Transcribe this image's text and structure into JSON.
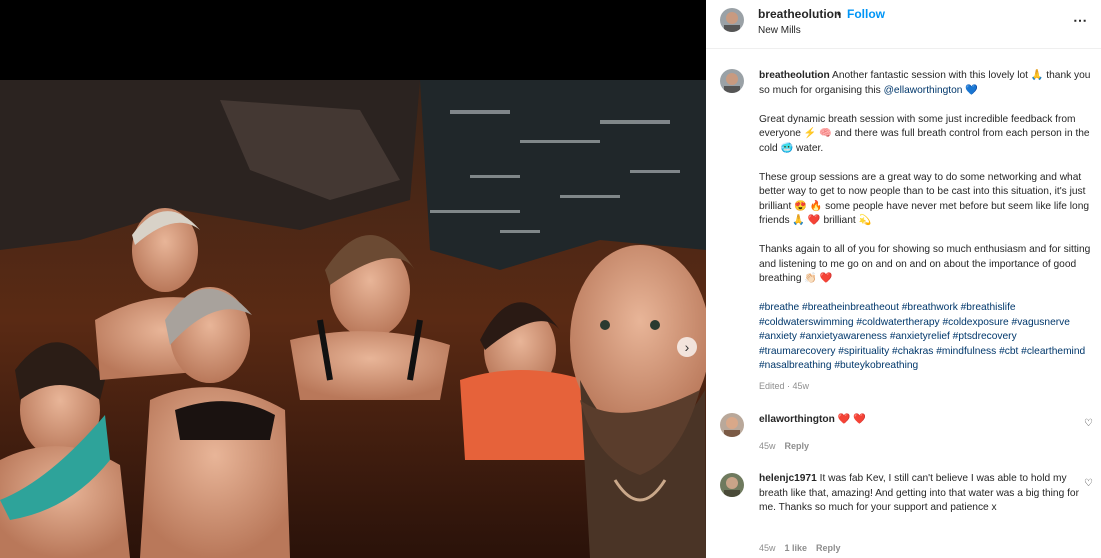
{
  "post": {
    "author": "breatheolution",
    "follow_label": "Follow",
    "dot": "•",
    "location": "New Mills",
    "more_icon": "⋯"
  },
  "caption": {
    "username": "breatheolution",
    "p1_a": "Another fantastic session with this lovely lot 🙏 thank you so much for organising this ",
    "mention": "@ellaworthington",
    "p1_b": " 💙",
    "p2": "Great dynamic breath session with some just incredible feedback from everyone ⚡ 🧠 and there was full breath control from each person in the cold 🥶 water.",
    "p3": "These group sessions are a great way to do some networking and what better way to get to now people than to be cast into this situation, it's just brilliant 😍 🔥 some people have never met before but seem like life long friends 🙏 ❤️ brilliant 💫",
    "p4": "Thanks again to all of you for showing so much enthusiasm and for sitting and listening to me go on and on and on about the importance of good breathing 👏🏻 ❤️",
    "hashtags": "#breathe #breatheinbreatheout #breathwork #breathislife #coldwaterswimming #coldwatertherapy #coldexposure #vagusnerve #anxiety #anxietyawareness #anxietyrelief #ptsdrecovery #traumarecovery #spirituality #chakras #mindfulness #cbt #clearthemind #nasalbreathing #buteykobreathing",
    "edited": "Edited · 45w"
  },
  "comments": [
    {
      "username": "ellaworthington",
      "text": "❤️ ❤️",
      "age": "45w",
      "likes": "",
      "reply": "Reply"
    },
    {
      "username": "helenjc1971",
      "text": "It was fab Kev, I still can't believe I was able to hold my breath like that, amazing! And getting into that water was a big thing for me. Thanks so much for your support and patience x",
      "age": "45w",
      "likes": "1 like",
      "reply": "Reply"
    }
  ],
  "icons": {
    "next": "›",
    "heart": "♡"
  },
  "colors": {
    "link_blue": "#0095f6",
    "tag_blue": "#00376b",
    "muted": "#8e8e8e"
  }
}
